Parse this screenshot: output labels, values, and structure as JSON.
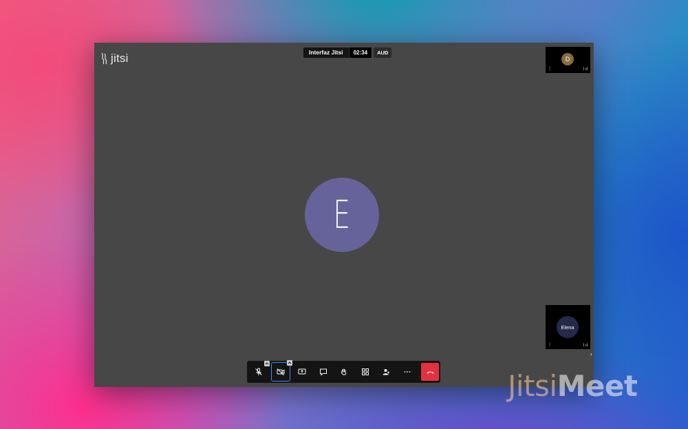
{
  "app": {
    "logo_text": "jitsi",
    "meeting_name": "Interfaz Jitsi",
    "timer": "02:34",
    "aud_badge": "AUD"
  },
  "main_participant": {
    "initial": "E",
    "avatar_color": "#66639b"
  },
  "filmstrip": [
    {
      "initial": "D",
      "avatar_color": "#8a6c3e"
    },
    {
      "label": "Elena",
      "avatar_color": "#252a49"
    }
  ],
  "toolbar": {
    "buttons": [
      {
        "icon": "mic-muted-icon"
      },
      {
        "icon": "camera-off-icon"
      },
      {
        "icon": "share-screen-icon"
      },
      {
        "icon": "chat-icon"
      },
      {
        "icon": "raise-hand-icon"
      },
      {
        "icon": "tile-view-icon"
      },
      {
        "icon": "invite-icon"
      },
      {
        "icon": "more-icon"
      },
      {
        "icon": "hangup-icon"
      }
    ],
    "hangup_color": "#e3313f",
    "active_outline_color": "#3f8cff"
  },
  "watermark": {
    "part1": "Jitsi",
    "part2": "Meet"
  }
}
